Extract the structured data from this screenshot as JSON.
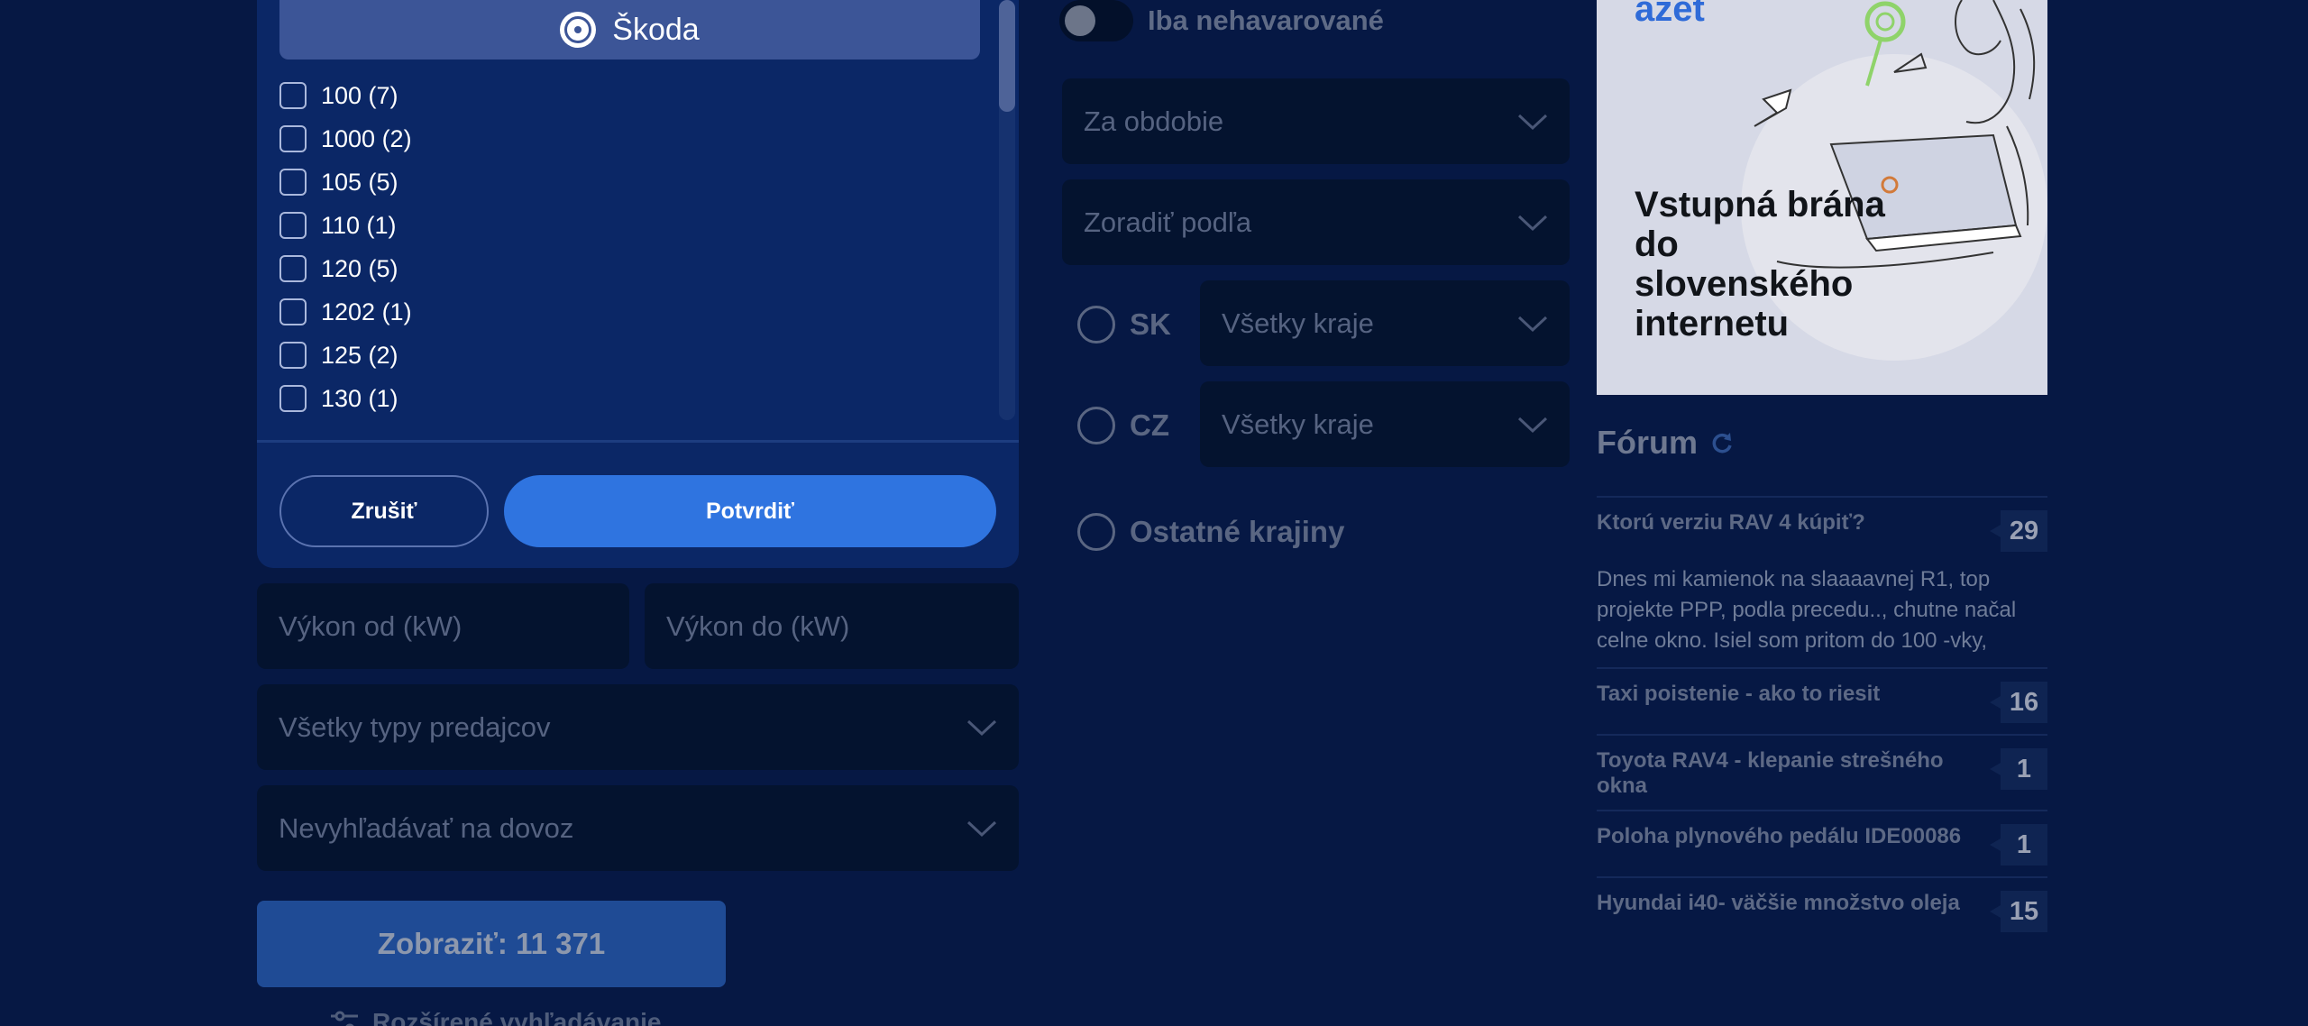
{
  "brand_panel": {
    "brand_name": "Škoda",
    "models": [
      "100 (7)",
      "1000 (2)",
      "105 (5)",
      "110 (1)",
      "120 (5)",
      "1202 (1)",
      "125 (2)",
      "130 (1)"
    ],
    "cancel_label": "Zrušiť",
    "confirm_label": "Potvrdiť"
  },
  "filters": {
    "power_from_placeholder": "Výkon od (kW)",
    "power_to_placeholder": "Výkon do (kW)",
    "seller_type": "Všetky typy predajcov",
    "import": "Nevyhľadávať na dovoz",
    "show_button": "Zobraziť: 11 371",
    "advanced_search": "Rozšírené vyhľadávanie",
    "accident_free_label": "Iba nehavarované",
    "period": "Za obdobie",
    "sort_by": "Zoradiť podľa",
    "region_sk_label": "SK",
    "region_sk_select": "Všetky kraje",
    "region_cz_label": "CZ",
    "region_cz_select": "Všetky kraje",
    "other_countries_label": "Ostatné krajiny"
  },
  "ad": {
    "logo": "azet",
    "text": "Vstupná brána do slovenského internetu"
  },
  "forum": {
    "title": "Fórum",
    "topics": [
      {
        "title": "Ktorú verziu RAV 4 kúpiť?",
        "count": "29",
        "snippet": "Dnes mi kamienok na slaaaavnej R1, top projekte PPP, podla precedu.., chutne načal celne okno. Isiel som pritom do 100 -vky,"
      },
      {
        "title": "Taxi poistenie - ako to riesit",
        "count": "16"
      },
      {
        "title": "Toyota RAV4 - klepanie strešného okna",
        "count": "1"
      },
      {
        "title": "Poloha plynového pedálu IDE00086",
        "count": "1"
      },
      {
        "title": "Hyundai i40- väčšie množstvo oleja",
        "count": "15"
      }
    ]
  },
  "colors": {
    "page_background": "#061844",
    "panel_background": "#0b2766",
    "accent_blue": "#2f74e0",
    "field_background": "#04132f"
  }
}
